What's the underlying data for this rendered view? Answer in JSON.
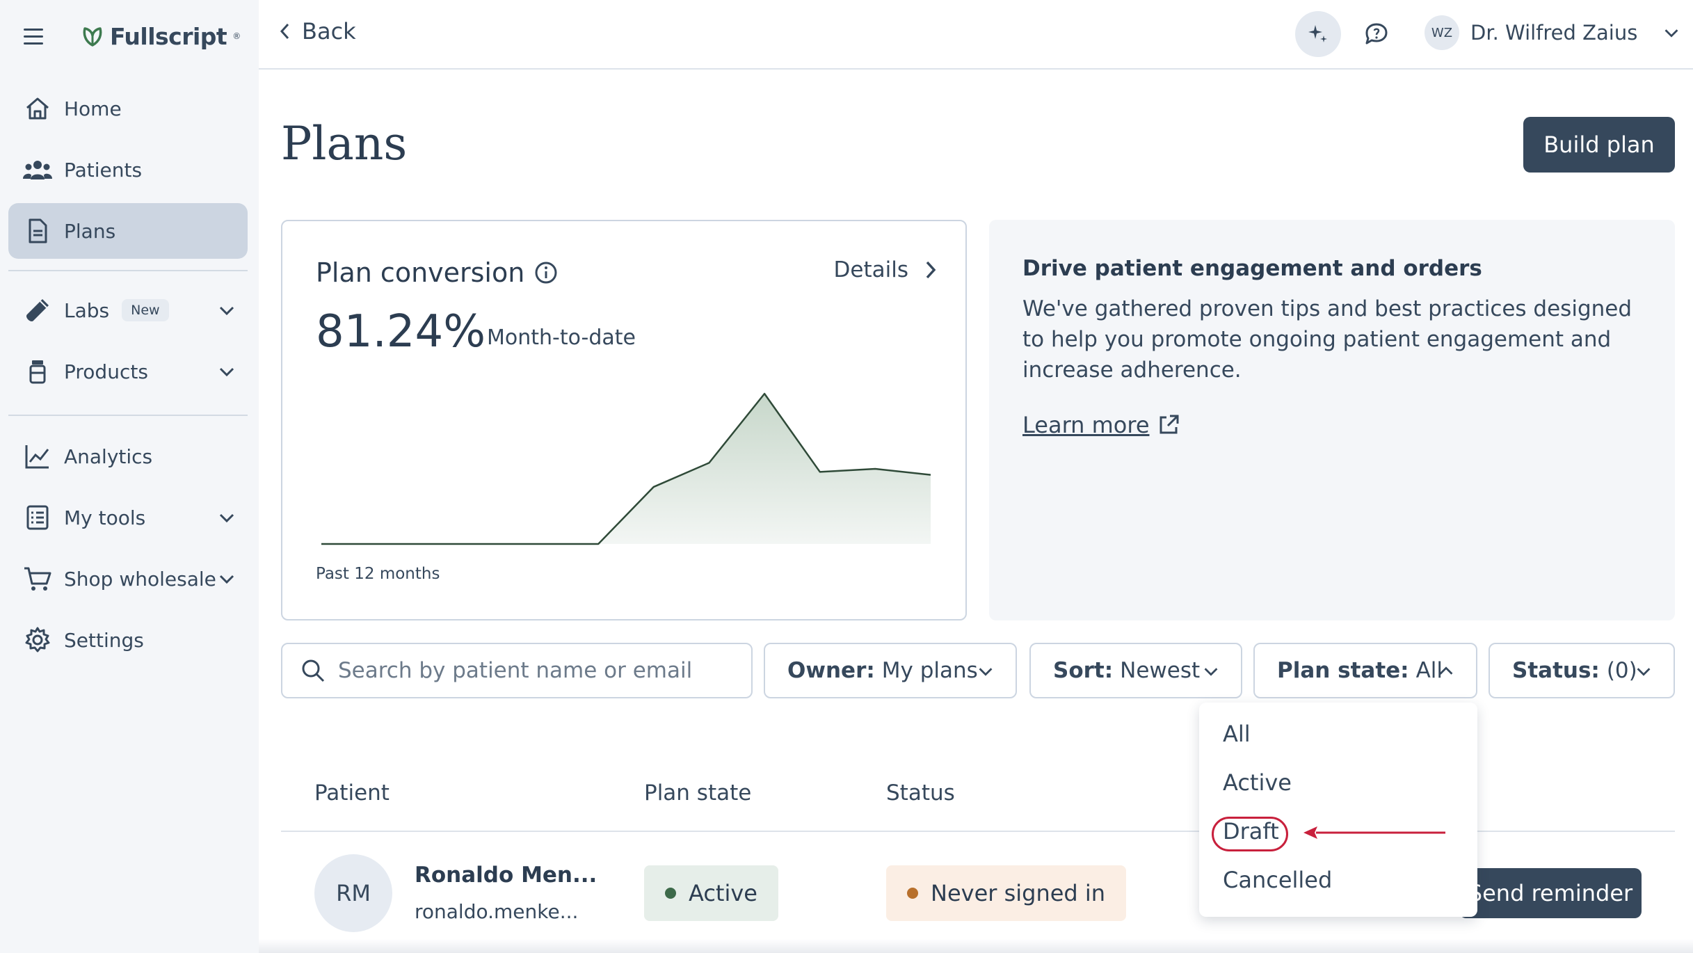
{
  "brand": {
    "name": "Fullscript",
    "mark": "®"
  },
  "sidebar": {
    "items": [
      {
        "label": "Home",
        "icon": "home-icon"
      },
      {
        "label": "Patients",
        "icon": "users-icon"
      },
      {
        "label": "Plans",
        "icon": "document-icon",
        "active": true
      },
      {
        "label": "Labs",
        "icon": "test-tube-icon",
        "badge": "New"
      },
      {
        "label": "Products",
        "icon": "bottle-icon"
      },
      {
        "label": "Analytics",
        "icon": "line-chart-icon"
      },
      {
        "label": "My tools",
        "icon": "checklist-icon"
      },
      {
        "label": "Shop wholesale",
        "icon": "cart-icon"
      },
      {
        "label": "Settings",
        "icon": "gear-icon"
      }
    ]
  },
  "topbar": {
    "back_label": "Back",
    "user_initials": "WZ",
    "user_name": "Dr. Wilfred Zaius"
  },
  "page": {
    "title": "Plans",
    "build_button": "Build plan"
  },
  "conversion_card": {
    "title": "Plan conversion",
    "details_label": "Details",
    "value": "81.24%",
    "period": "Month-to-date",
    "footer": "Past 12 months"
  },
  "chart_data": {
    "type": "area",
    "x": [
      1,
      2,
      3,
      4,
      5,
      6,
      7,
      8,
      9,
      10,
      11,
      12
    ],
    "values": [
      0,
      0,
      0,
      0,
      0,
      0,
      38,
      54,
      100,
      48,
      50,
      46
    ],
    "ylim": [
      0,
      100
    ],
    "grid": false,
    "color": "#2f4a38",
    "fill_color": "#dbe5dd"
  },
  "info_panel": {
    "heading": "Drive patient engagement and orders",
    "body": "We've gathered proven tips and best practices designed to help you promote ongoing patient engagement and increase adherence.",
    "link_label": "Learn more"
  },
  "filters": {
    "search_placeholder": "Search by patient name or email",
    "owner_key": "Owner:",
    "owner_value": "My plans",
    "sort_key": "Sort:",
    "sort_value": "Newest",
    "plan_state_key": "Plan state:",
    "plan_state_value": "All",
    "status_key": "Status:",
    "status_value": "(0)"
  },
  "plan_state_menu": {
    "options": [
      "All",
      "Active",
      "Draft",
      "Cancelled"
    ],
    "highlighted": "Draft",
    "highlight_color": "#c8203c"
  },
  "table": {
    "headers": [
      "Patient",
      "Plan state",
      "Status"
    ],
    "rows": [
      {
        "initials": "RM",
        "name": "Ronaldo Men...",
        "email": "ronaldo.menke...",
        "plan_state": "Active",
        "status": "Never signed in",
        "action": "Send reminder"
      }
    ]
  }
}
